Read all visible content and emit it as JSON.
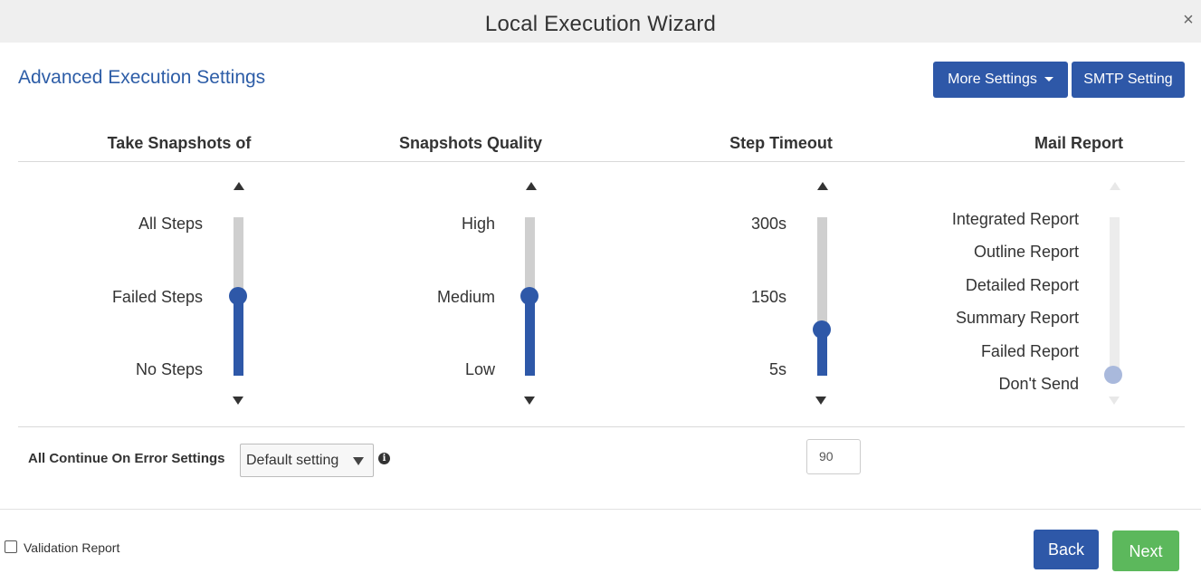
{
  "window": {
    "title": "Local Execution Wizard",
    "close_icon": "close-icon"
  },
  "section_title": "Advanced Execution Settings",
  "toolbar": {
    "more_settings_label": "More Settings",
    "smtp_label": "SMTP Setting"
  },
  "columns": {
    "snapshots": {
      "heading": "Take Snapshots of",
      "options": [
        "All Steps",
        "Failed Steps",
        "No Steps"
      ],
      "selected": "Failed Steps"
    },
    "quality": {
      "heading": "Snapshots Quality",
      "options": [
        "High",
        "Medium",
        "Low"
      ],
      "selected": "Medium"
    },
    "timeout": {
      "heading": "Step Timeout",
      "ticks": [
        "300s",
        "150s",
        "5s"
      ],
      "value_seconds": 90
    },
    "mail": {
      "heading": "Mail Report",
      "options": [
        "Integrated Report",
        "Outline Report",
        "Detailed Report",
        "Summary Report",
        "Failed Report",
        "Don't Send"
      ],
      "selected": "Don't Send",
      "disabled": true
    }
  },
  "continue_on_error": {
    "label": "All Continue On Error Settings",
    "selected": "Default setting",
    "info_icon": "info-icon"
  },
  "timeout_input": {
    "value": "90"
  },
  "footer": {
    "validation_label": "Validation Report",
    "validation_checked": false,
    "back_label": "Back",
    "next_label": "Next"
  },
  "colors": {
    "accent": "#2e58a8",
    "title": "#2d5da7",
    "next": "#5cb85c"
  }
}
